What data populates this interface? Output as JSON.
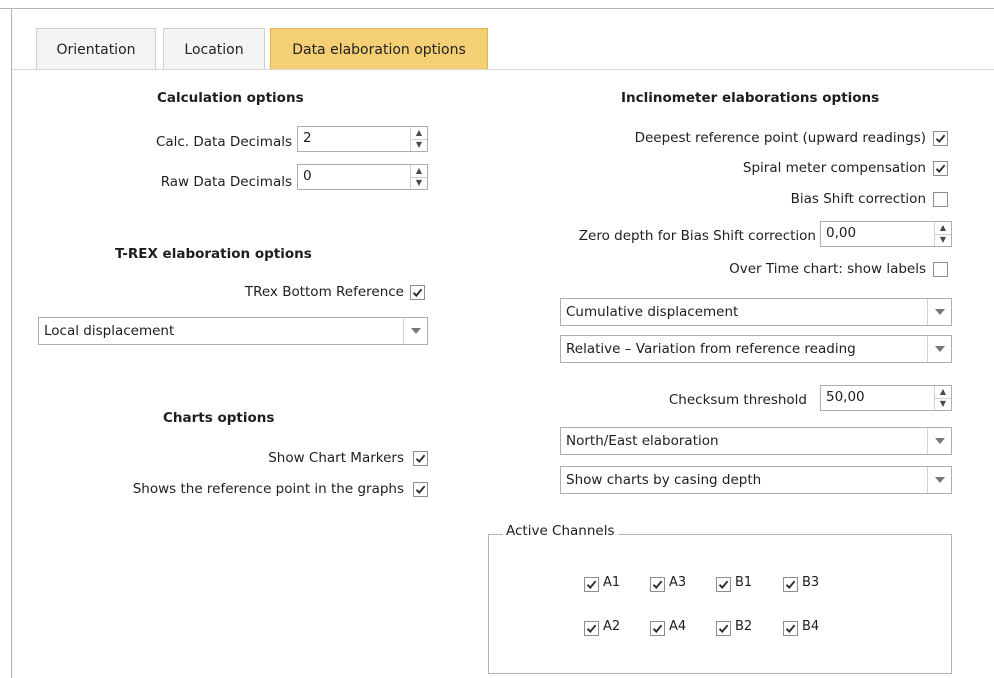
{
  "tabs": [
    {
      "label": "Orientation",
      "active": false
    },
    {
      "label": "Location",
      "active": false
    },
    {
      "label": "Data elaboration options",
      "active": true
    }
  ],
  "colors": {
    "active_tab": "#f5cf74",
    "border": "#b4b4b4"
  },
  "calc": {
    "header": "Calculation options",
    "calc_decimals_label": "Calc. Data Decimals",
    "calc_decimals_value": "2",
    "raw_decimals_label": "Raw Data Decimals",
    "raw_decimals_value": "0"
  },
  "trex": {
    "header": "T-REX elaboration options",
    "bottom_ref_label": "TRex Bottom Reference",
    "bottom_ref_checked": true,
    "dropdown_value": "Local displacement"
  },
  "charts": {
    "header": "Charts options",
    "markers_label": "Show Chart Markers",
    "markers_checked": true,
    "refpoint_label": "Shows the reference point in the graphs",
    "refpoint_checked": true
  },
  "incl": {
    "header": "Inclinometer elaborations options",
    "deepest_label": "Deepest reference point (upward readings)",
    "deepest_checked": true,
    "spiral_label": "Spiral meter compensation",
    "spiral_checked": true,
    "bias_label": "Bias Shift correction",
    "bias_checked": false,
    "zero_depth_label": "Zero depth for Bias Shift correction",
    "zero_depth_value": "0,00",
    "overtime_label": "Over Time chart: show labels",
    "overtime_checked": false,
    "dropdown1": "Cumulative displacement",
    "dropdown2": "Relative – Variation from reference reading",
    "checksum_label": "Checksum threshold",
    "checksum_value": "50,00",
    "dropdown3": "North/East elaboration",
    "dropdown4": "Show charts by casing depth"
  },
  "channels": {
    "title": "Active Channels",
    "items": [
      {
        "label": "A1",
        "checked": true
      },
      {
        "label": "A3",
        "checked": true
      },
      {
        "label": "B1",
        "checked": true
      },
      {
        "label": "B3",
        "checked": true
      },
      {
        "label": "A2",
        "checked": true
      },
      {
        "label": "A4",
        "checked": true
      },
      {
        "label": "B2",
        "checked": true
      },
      {
        "label": "B4",
        "checked": true
      }
    ]
  }
}
